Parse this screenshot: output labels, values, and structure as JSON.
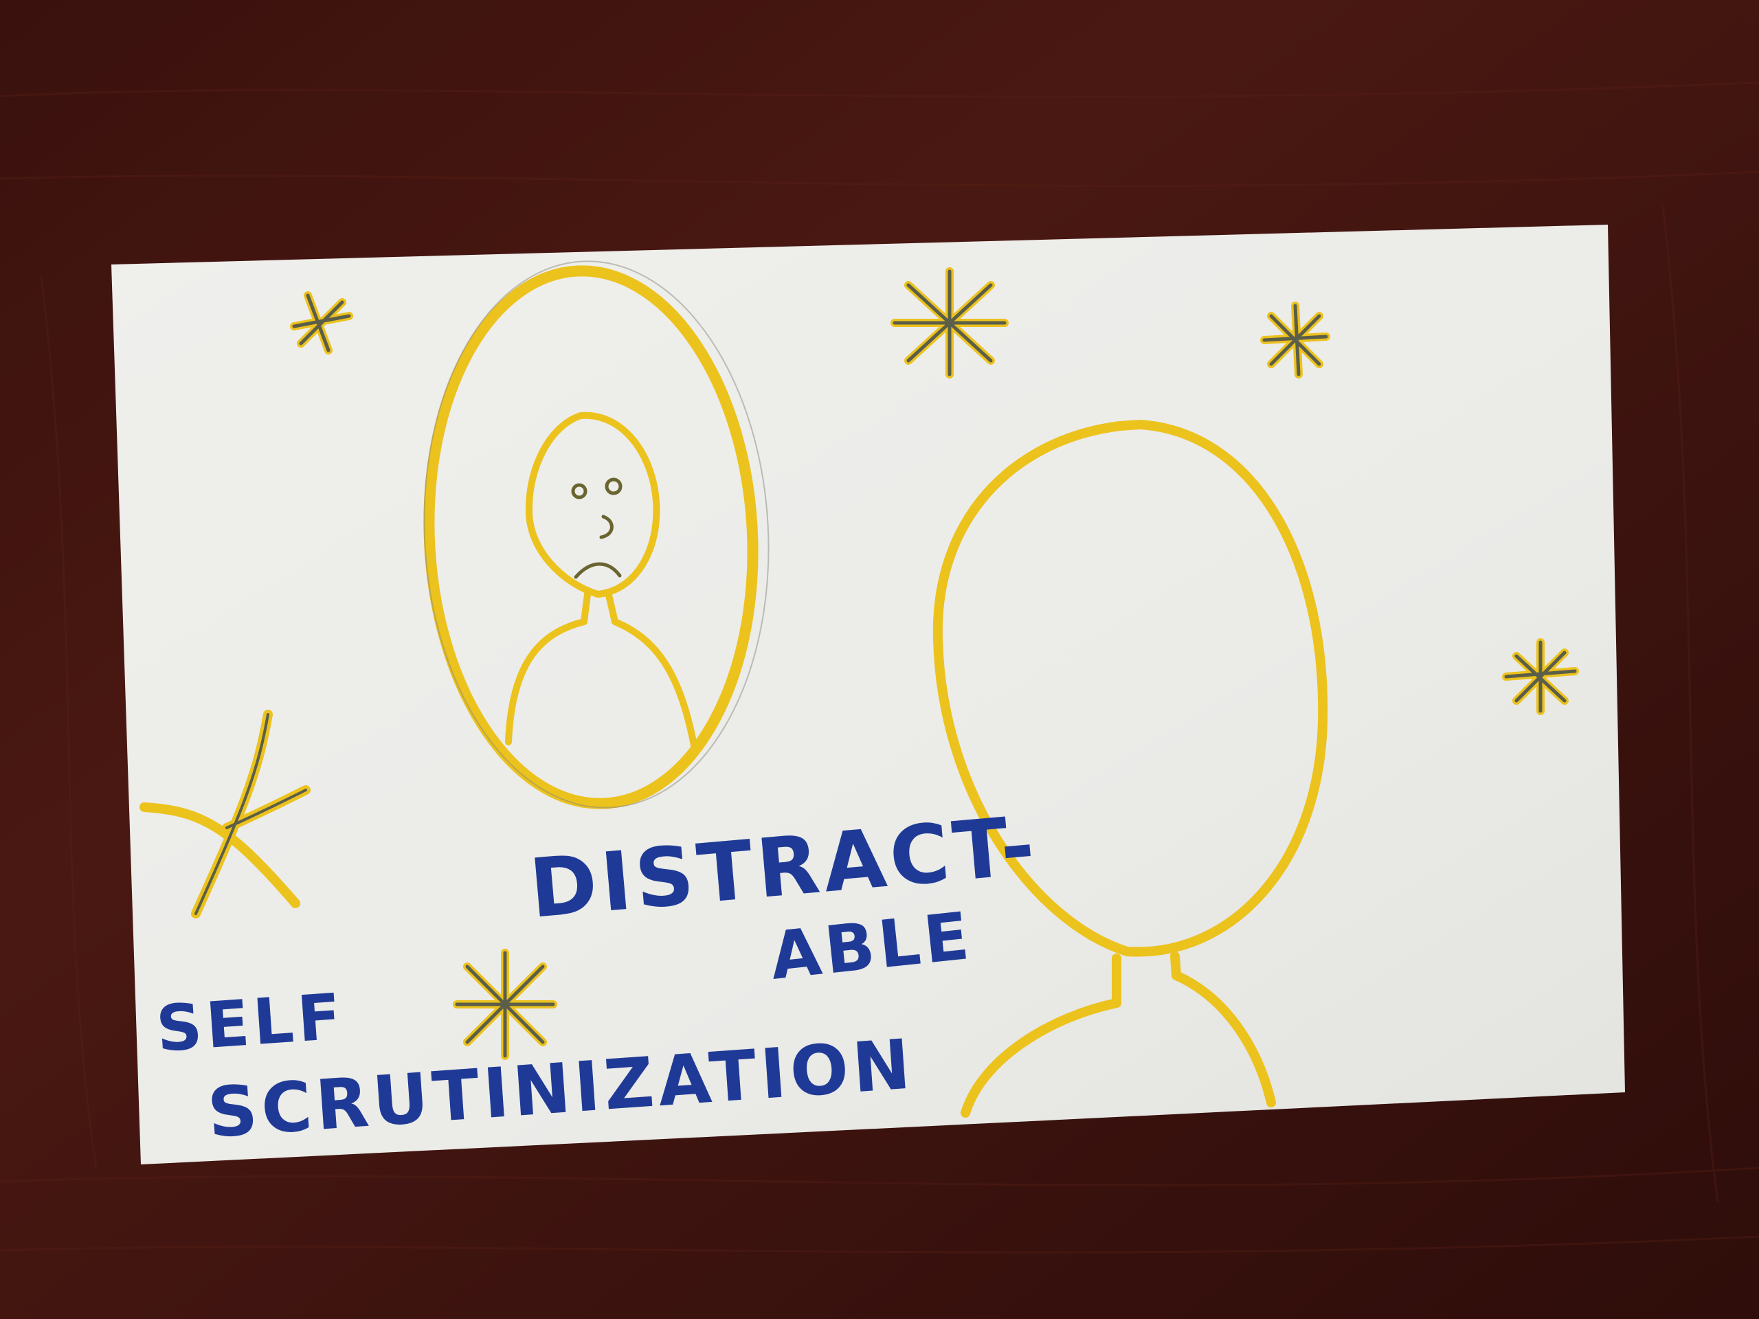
{
  "card": {
    "words": {
      "distract": "DISTRACT-",
      "able": "ABLE",
      "self": "SELF",
      "scrutinization": "SCRUTINIZATION"
    }
  },
  "colors": {
    "table_wood": "#3d1511",
    "card_paper": "#ecece9",
    "marker_yellow": "#ecc21d",
    "marker_blue": "#1f3a96",
    "pencil_gray": "#5b5e48"
  }
}
